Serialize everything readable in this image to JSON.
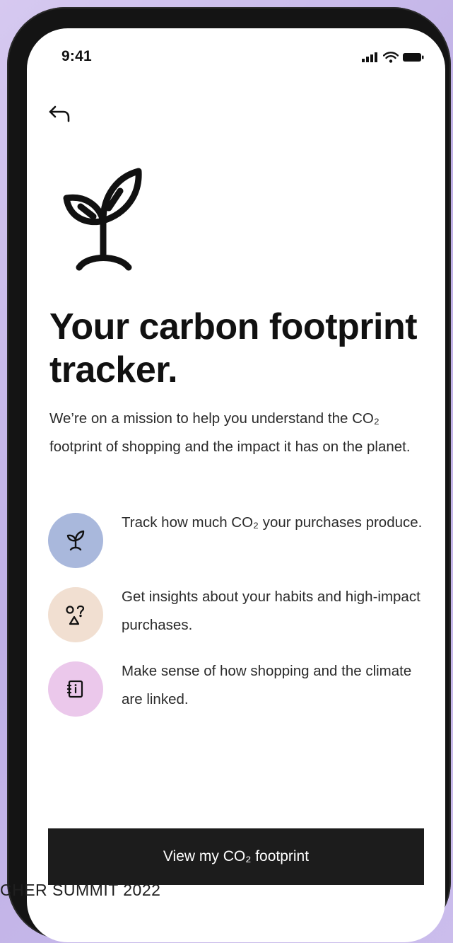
{
  "status_bar": {
    "time": "9:41"
  },
  "page": {
    "title": "Your carbon footprint tracker.",
    "intro": "We’re on a mission to help you understand the CO₂ footprint of shopping and the impact it has on the planet."
  },
  "features": [
    {
      "text": "Track how much CO₂ your purchases produce.",
      "icon": "sprout-icon",
      "color": "#a9b8dc"
    },
    {
      "text": "Get insights about your habits and high-impact purchases.",
      "icon": "insights-shapes-icon",
      "color": "#f1dfd1"
    },
    {
      "text": "Make sense of how shopping and the climate are linked.",
      "icon": "info-book-icon",
      "color": "#ebc8eb"
    }
  ],
  "cta": {
    "label": "View my CO₂ footprint"
  },
  "watermark": "CHER SUMMIT 2022"
}
